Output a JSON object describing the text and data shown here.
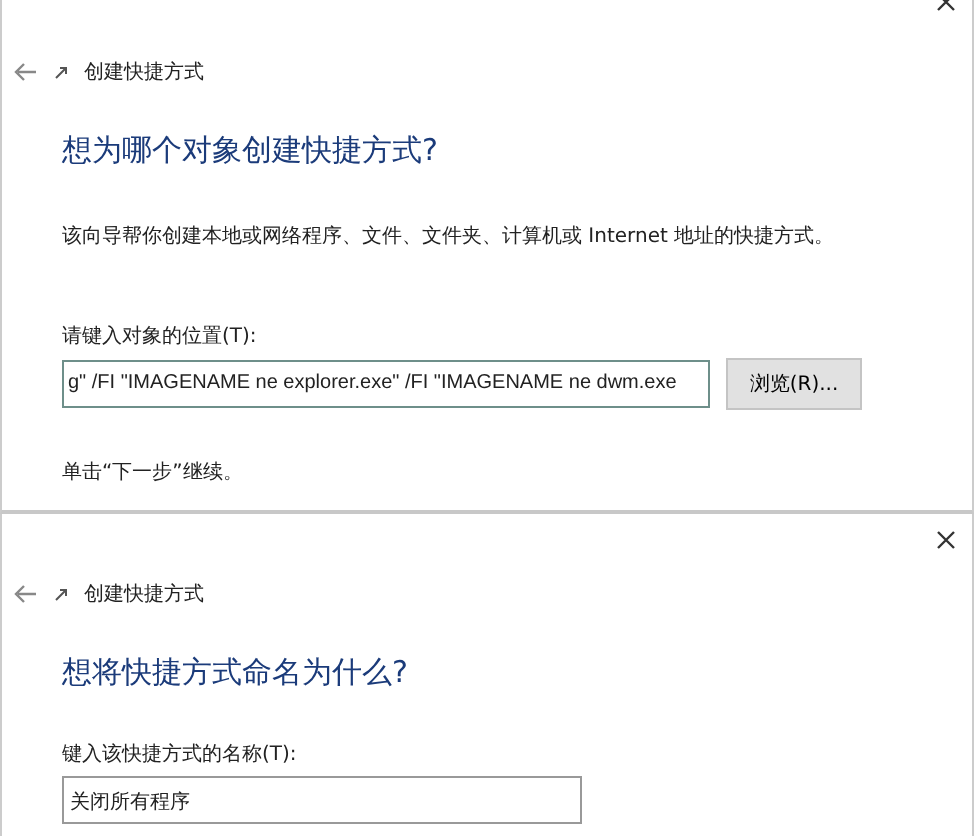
{
  "panels": [
    {
      "wizard_title": "创建快捷方式",
      "heading": "想为哪个对象创建快捷方式?",
      "description": "该向导帮你创建本地或网络程序、文件、文件夹、计算机或 Internet 地址的快捷方式。",
      "field_label": "请键入对象的位置(T):",
      "field_value": "g\" /FI \"IMAGENAME ne explorer.exe\" /FI \"IMAGENAME ne dwm.exe",
      "button": "浏览(R)...",
      "hint": "单击“下一步”继续。",
      "close_clipped": true
    },
    {
      "wizard_title": "创建快捷方式",
      "heading": "想将快捷方式命名为什么?",
      "field_label": "键入该快捷方式的名称(T):",
      "field_value": "关闭所有程序",
      "close_clipped": false
    }
  ]
}
